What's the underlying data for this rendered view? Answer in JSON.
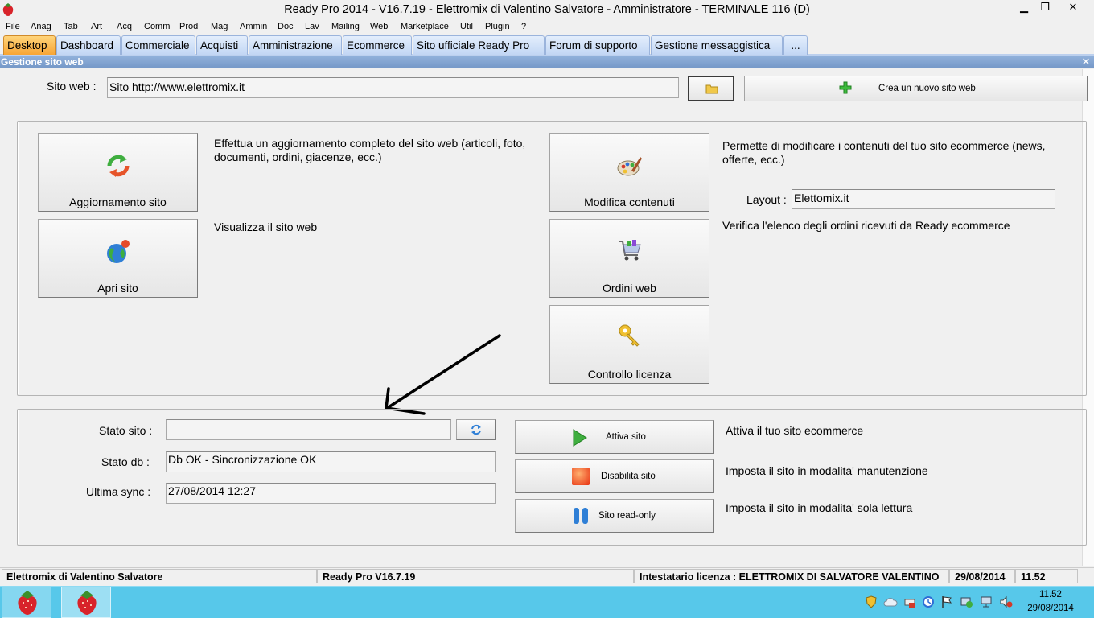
{
  "window": {
    "title": "Ready Pro 2014 - V16.7.19 - Elettromix di Valentino Salvatore - Amministratore - TERMINALE 116 (D)",
    "minimize_glyph": "▁",
    "maximize_glyph": "❐",
    "close_glyph": "✕"
  },
  "menu": [
    "File",
    "Anag",
    "Tab",
    "Art",
    "Acq",
    "Comm",
    "Prod",
    "Mag",
    "Ammin",
    "Doc",
    "Lav",
    "Mailing",
    "Web",
    "Marketplace",
    "Util",
    "Plugin",
    "?"
  ],
  "tabs": [
    {
      "label": "Desktop",
      "active": true
    },
    {
      "label": "Dashboard",
      "active": false
    },
    {
      "label": "Commerciale",
      "active": false
    },
    {
      "label": "Acquisti",
      "active": false
    },
    {
      "label": "Amministrazione",
      "active": false
    },
    {
      "label": "Ecommerce",
      "active": false
    },
    {
      "label": "Sito ufficiale Ready Pro",
      "active": false
    },
    {
      "label": "Forum di supporto",
      "active": false
    },
    {
      "label": "Gestione messaggistica",
      "active": false
    },
    {
      "label": "...",
      "active": false
    }
  ],
  "panel": {
    "title": "Gestione sito web",
    "close_glyph": "✕"
  },
  "site": {
    "label": "Sito web :",
    "value": "Sito http://www.elettromix.it",
    "new_site_button": "Crea un nuovo sito web"
  },
  "actions": {
    "update": {
      "label": "Aggiornamento sito",
      "description": "Effettua un aggiornamento completo del sito web (articoli, foto, documenti, ordini, giacenze, ecc.)"
    },
    "open": {
      "label": "Apri sito",
      "description": "Visualizza il sito web"
    },
    "edit": {
      "label": "Modifica contenuti",
      "description": "Permette di modificare i contenuti del tuo sito ecommerce (news, offerte, ecc.)"
    },
    "layout": {
      "label": "Layout :",
      "value": "Elettomix.it"
    },
    "orders": {
      "label": "Ordini web",
      "description": "Verifica l'elenco degli ordini ricevuti da Ready ecommerce"
    },
    "license": {
      "label": "Controllo licenza"
    }
  },
  "status": {
    "site_label": "Stato sito :",
    "site_value": "",
    "db_label": "Stato db :",
    "db_value": "Db OK - Sincronizzazione OK",
    "sync_label": "Ultima sync :",
    "sync_value": "27/08/2014 12:27",
    "activate_button": "Attiva sito",
    "activate_description": "Attiva il tuo sito ecommerce",
    "disable_button": "Disabilita sito",
    "disable_description": "Imposta il sito in modalita' manutenzione",
    "readonly_button": "Sito read-only",
    "readonly_description": "Imposta il sito in modalita' sola lettura"
  },
  "statusbar": {
    "company": "Elettromix di Valentino Salvatore",
    "version": "Ready Pro V16.7.19",
    "license": "Intestatario licenza : ELETTROMIX DI SALVATORE VALENTINO",
    "date": "29/08/2014",
    "time": "11.52"
  },
  "taskbar": {
    "clock_time": "11.52",
    "clock_date": "29/08/2014"
  },
  "colors": {
    "accent": "#f7a534",
    "tab": "#c2d6f4",
    "panel_header": "#7f9fcf",
    "taskbar": "#57c8ea"
  }
}
